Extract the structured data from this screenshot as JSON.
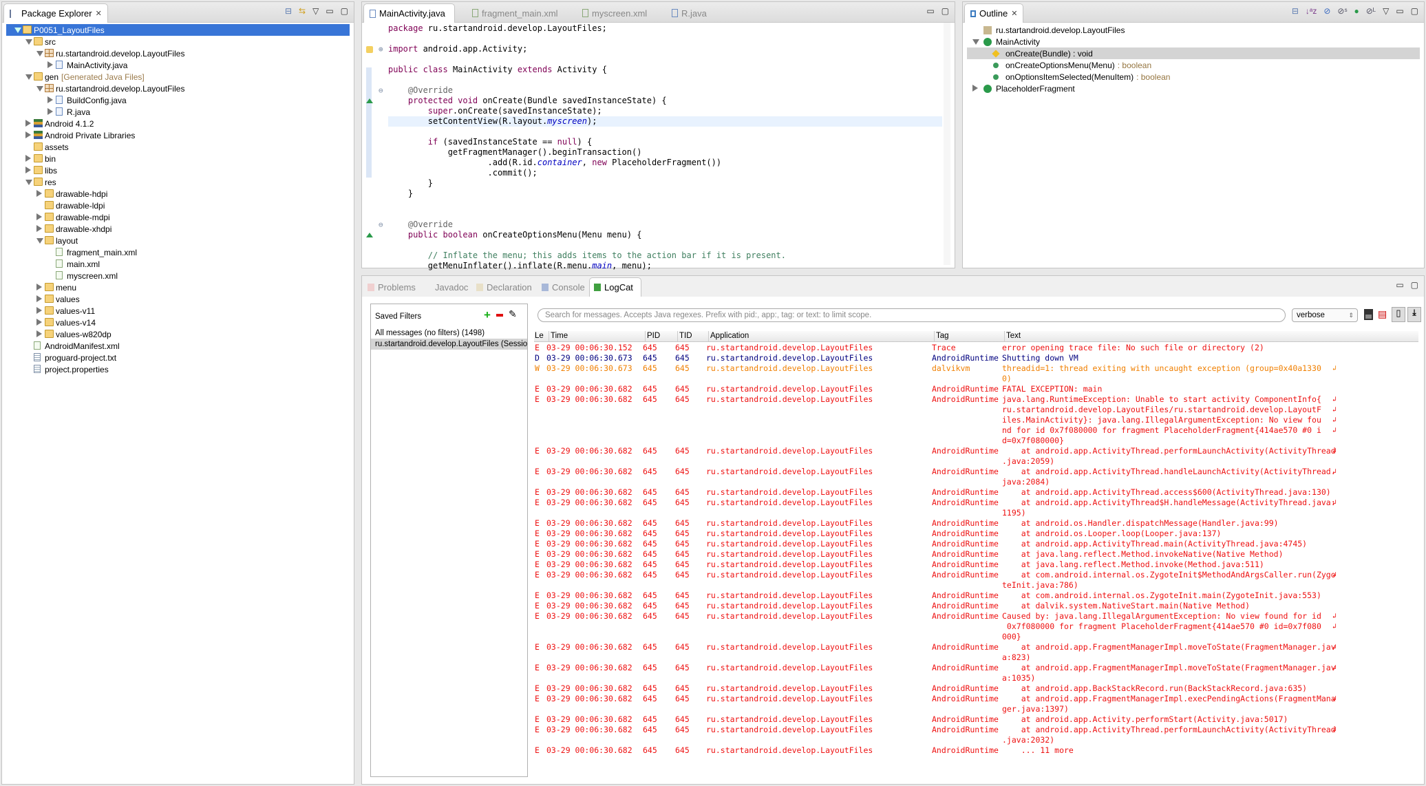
{
  "colors": {
    "error": "#ee1111",
    "debug": "#00007f",
    "warn": "#f07f00",
    "selection": "#3875d7"
  },
  "package_explorer": {
    "title": "Package Explorer",
    "items": [
      {
        "label": "P0051_LayoutFiles",
        "depth": 0,
        "exp": "open",
        "icon": "project",
        "selected": true
      },
      {
        "label": "src",
        "depth": 1,
        "exp": "open",
        "icon": "srcfolder"
      },
      {
        "label": "ru.startandroid.develop.LayoutFiles",
        "depth": 2,
        "exp": "open",
        "icon": "package"
      },
      {
        "label": "MainActivity.java",
        "depth": 3,
        "exp": "closed",
        "icon": "java"
      },
      {
        "label": "gen",
        "suffix": "[Generated Java Files]",
        "depth": 1,
        "exp": "open",
        "icon": "srcfolder"
      },
      {
        "label": "ru.startandroid.develop.LayoutFiles",
        "depth": 2,
        "exp": "open",
        "icon": "package"
      },
      {
        "label": "BuildConfig.java",
        "depth": 3,
        "exp": "closed",
        "icon": "java"
      },
      {
        "label": "R.java",
        "depth": 3,
        "exp": "closed",
        "icon": "java"
      },
      {
        "label": "Android 4.1.2",
        "depth": 1,
        "exp": "closed",
        "icon": "lib"
      },
      {
        "label": "Android Private Libraries",
        "depth": 1,
        "exp": "closed",
        "icon": "lib"
      },
      {
        "label": "assets",
        "depth": 1,
        "exp": "none",
        "icon": "folder"
      },
      {
        "label": "bin",
        "depth": 1,
        "exp": "closed",
        "icon": "folder"
      },
      {
        "label": "libs",
        "depth": 1,
        "exp": "closed",
        "icon": "folder"
      },
      {
        "label": "res",
        "depth": 1,
        "exp": "open",
        "icon": "folder"
      },
      {
        "label": "drawable-hdpi",
        "depth": 2,
        "exp": "closed",
        "icon": "folder"
      },
      {
        "label": "drawable-ldpi",
        "depth": 2,
        "exp": "none",
        "icon": "folder"
      },
      {
        "label": "drawable-mdpi",
        "depth": 2,
        "exp": "closed",
        "icon": "folder"
      },
      {
        "label": "drawable-xhdpi",
        "depth": 2,
        "exp": "closed",
        "icon": "folder"
      },
      {
        "label": "layout",
        "depth": 2,
        "exp": "open",
        "icon": "folder"
      },
      {
        "label": "fragment_main.xml",
        "depth": 3,
        "exp": "none",
        "icon": "xml"
      },
      {
        "label": "main.xml",
        "depth": 3,
        "exp": "none",
        "icon": "xml"
      },
      {
        "label": "myscreen.xml",
        "depth": 3,
        "exp": "none",
        "icon": "xml"
      },
      {
        "label": "menu",
        "depth": 2,
        "exp": "closed",
        "icon": "folder"
      },
      {
        "label": "values",
        "depth": 2,
        "exp": "closed",
        "icon": "folder"
      },
      {
        "label": "values-v11",
        "depth": 2,
        "exp": "closed",
        "icon": "folder"
      },
      {
        "label": "values-v14",
        "depth": 2,
        "exp": "closed",
        "icon": "folder"
      },
      {
        "label": "values-w820dp",
        "depth": 2,
        "exp": "closed",
        "icon": "folder"
      },
      {
        "label": "AndroidManifest.xml",
        "depth": 1,
        "exp": "none",
        "icon": "xml"
      },
      {
        "label": "proguard-project.txt",
        "depth": 1,
        "exp": "none",
        "icon": "txt"
      },
      {
        "label": "project.properties",
        "depth": 1,
        "exp": "none",
        "icon": "txt"
      }
    ]
  },
  "editor": {
    "tabs": [
      "MainActivity.java",
      "fragment_main.xml",
      "myscreen.xml",
      "R.java"
    ],
    "active_tab": 0,
    "current_line": 9,
    "lines": [
      [
        [
          "package",
          "kw"
        ],
        [
          " ru.startandroid.develop.LayoutFiles;",
          ""
        ]
      ],
      [],
      [
        [
          "import",
          "kw"
        ],
        [
          " android.app.Activity;",
          ""
        ]
      ],
      [],
      [
        [
          "public",
          "kw"
        ],
        [
          " ",
          ""
        ],
        [
          "class",
          "kw"
        ],
        [
          " MainActivity ",
          ""
        ],
        [
          "extends",
          "kw"
        ],
        [
          " Activity {",
          ""
        ]
      ],
      [],
      [
        [
          "    @Override",
          "ann"
        ]
      ],
      [
        [
          "    ",
          ""
        ],
        [
          "protected",
          "kw"
        ],
        [
          " ",
          ""
        ],
        [
          "void",
          "kw"
        ],
        [
          " onCreate(Bundle savedInstanceState) {",
          ""
        ]
      ],
      [
        [
          "        ",
          ""
        ],
        [
          "super",
          "kw"
        ],
        [
          ".onCreate(savedInstanceState);",
          ""
        ]
      ],
      [
        [
          "        setContentView(R.layout.",
          ""
        ],
        [
          "myscreen",
          "fld"
        ],
        [
          ");",
          ""
        ]
      ],
      [],
      [
        [
          "        ",
          ""
        ],
        [
          "if",
          "kw"
        ],
        [
          " (savedInstanceState == ",
          ""
        ],
        [
          "null",
          "kw"
        ],
        [
          ") {",
          ""
        ]
      ],
      [
        [
          "            getFragmentManager().beginTransaction()",
          ""
        ]
      ],
      [
        [
          "                    .add(R.id.",
          ""
        ],
        [
          "container",
          "fld"
        ],
        [
          ", ",
          ""
        ],
        [
          "new",
          "kw"
        ],
        [
          " PlaceholderFragment())",
          ""
        ]
      ],
      [
        [
          "                    .commit();",
          ""
        ]
      ],
      [
        [
          "        }",
          ""
        ]
      ],
      [
        [
          "    }",
          ""
        ]
      ],
      [],
      [],
      [
        [
          "    @Override",
          "ann"
        ]
      ],
      [
        [
          "    ",
          ""
        ],
        [
          "public",
          "kw"
        ],
        [
          " ",
          ""
        ],
        [
          "boolean",
          "kw"
        ],
        [
          " onCreateOptionsMenu(Menu menu) {",
          ""
        ]
      ],
      [],
      [
        [
          "        // Inflate the menu; this adds items to the action bar if it is present.",
          "cmt"
        ]
      ],
      [
        [
          "        getMenuInflater().inflate(R.menu.",
          ""
        ],
        [
          "main",
          "fld"
        ],
        [
          ", menu);",
          ""
        ]
      ]
    ]
  },
  "outline": {
    "title": "Outline",
    "items": [
      {
        "label": "ru.startandroid.develop.LayoutFiles",
        "ret": "",
        "depth": 0,
        "icon": "package"
      },
      {
        "label": "MainActivity",
        "ret": "",
        "depth": 0,
        "icon": "class",
        "exp": "open"
      },
      {
        "label": "onCreate(Bundle) : void",
        "ret": "",
        "depth": 1,
        "icon": "protected",
        "selected": true
      },
      {
        "label": "onCreateOptionsMenu(Menu)",
        "ret": ": boolean",
        "depth": 1,
        "icon": "public"
      },
      {
        "label": "onOptionsItemSelected(MenuItem)",
        "ret": ": boolean",
        "depth": 1,
        "icon": "public"
      },
      {
        "label": "PlaceholderFragment",
        "ret": "",
        "depth": 0,
        "icon": "class",
        "exp": "closed"
      }
    ]
  },
  "bottom": {
    "tabs": [
      "Problems",
      "Javadoc",
      "Declaration",
      "Console",
      "LogCat"
    ],
    "active_tab": 4,
    "saved_filters": {
      "title": "Saved Filters",
      "items": [
        "All messages (no filters) (1498)",
        "ru.startandroid.develop.LayoutFiles (Session)"
      ],
      "selected": 1
    },
    "search_placeholder": "Search for messages. Accepts Java regexes. Prefix with pid:, app:, tag: or text: to limit scope.",
    "level_select": "verbose",
    "columns": [
      "Le",
      "Time",
      "PID",
      "TID",
      "Application",
      "Tag",
      "Text"
    ],
    "rows": [
      {
        "l": "E",
        "t": "03-29 00:06:30.152",
        "tag": "Trace",
        "text": [
          "error opening trace file: No such file or directory (2)"
        ]
      },
      {
        "l": "D",
        "t": "03-29 00:06:30.673",
        "tag": "AndroidRuntime",
        "text": [
          "Shutting down VM"
        ]
      },
      {
        "l": "W",
        "t": "03-29 00:06:30.673",
        "tag": "dalvikvm",
        "text": [
          "threadid=1: thread exiting with uncaught exception (group=0x40a1330",
          "0)"
        ]
      },
      {
        "l": "E",
        "t": "03-29 00:06:30.682",
        "tag": "AndroidRuntime",
        "text": [
          "FATAL EXCEPTION: main"
        ]
      },
      {
        "l": "E",
        "t": "03-29 00:06:30.682",
        "tag": "AndroidRuntime",
        "text": [
          "java.lang.RuntimeException: Unable to start activity ComponentInfo{",
          "ru.startandroid.develop.LayoutFiles/ru.startandroid.develop.LayoutF",
          "iles.MainActivity}: java.lang.IllegalArgumentException: No view fou",
          "nd for id 0x7f080000 for fragment PlaceholderFragment{414ae570 #0 i",
          "d=0x7f080000}"
        ]
      },
      {
        "l": "E",
        "t": "03-29 00:06:30.682",
        "tag": "AndroidRuntime",
        "text": [
          "    at android.app.ActivityThread.performLaunchActivity(ActivityThread",
          ".java:2059)"
        ]
      },
      {
        "l": "E",
        "t": "03-29 00:06:30.682",
        "tag": "AndroidRuntime",
        "text": [
          "    at android.app.ActivityThread.handleLaunchActivity(ActivityThread.",
          "java:2084)"
        ]
      },
      {
        "l": "E",
        "t": "03-29 00:06:30.682",
        "tag": "AndroidRuntime",
        "text": [
          "    at android.app.ActivityThread.access$600(ActivityThread.java:130)"
        ]
      },
      {
        "l": "E",
        "t": "03-29 00:06:30.682",
        "tag": "AndroidRuntime",
        "text": [
          "    at android.app.ActivityThread$H.handleMessage(ActivityThread.java:",
          "1195)"
        ]
      },
      {
        "l": "E",
        "t": "03-29 00:06:30.682",
        "tag": "AndroidRuntime",
        "text": [
          "    at android.os.Handler.dispatchMessage(Handler.java:99)"
        ]
      },
      {
        "l": "E",
        "t": "03-29 00:06:30.682",
        "tag": "AndroidRuntime",
        "text": [
          "    at android.os.Looper.loop(Looper.java:137)"
        ]
      },
      {
        "l": "E",
        "t": "03-29 00:06:30.682",
        "tag": "AndroidRuntime",
        "text": [
          "    at android.app.ActivityThread.main(ActivityThread.java:4745)"
        ]
      },
      {
        "l": "E",
        "t": "03-29 00:06:30.682",
        "tag": "AndroidRuntime",
        "text": [
          "    at java.lang.reflect.Method.invokeNative(Native Method)"
        ]
      },
      {
        "l": "E",
        "t": "03-29 00:06:30.682",
        "tag": "AndroidRuntime",
        "text": [
          "    at java.lang.reflect.Method.invoke(Method.java:511)"
        ]
      },
      {
        "l": "E",
        "t": "03-29 00:06:30.682",
        "tag": "AndroidRuntime",
        "text": [
          "    at com.android.internal.os.ZygoteInit$MethodAndArgsCaller.run(Zygo",
          "teInit.java:786)"
        ]
      },
      {
        "l": "E",
        "t": "03-29 00:06:30.682",
        "tag": "AndroidRuntime",
        "text": [
          "    at com.android.internal.os.ZygoteInit.main(ZygoteInit.java:553)"
        ]
      },
      {
        "l": "E",
        "t": "03-29 00:06:30.682",
        "tag": "AndroidRuntime",
        "text": [
          "    at dalvik.system.NativeStart.main(Native Method)"
        ]
      },
      {
        "l": "E",
        "t": "03-29 00:06:30.682",
        "tag": "AndroidRuntime",
        "text": [
          "Caused by: java.lang.IllegalArgumentException: No view found for id",
          " 0x7f080000 for fragment PlaceholderFragment{414ae570 #0 id=0x7f080",
          "000}"
        ]
      },
      {
        "l": "E",
        "t": "03-29 00:06:30.682",
        "tag": "AndroidRuntime",
        "text": [
          "    at android.app.FragmentManagerImpl.moveToState(FragmentManager.jav",
          "a:823)"
        ]
      },
      {
        "l": "E",
        "t": "03-29 00:06:30.682",
        "tag": "AndroidRuntime",
        "text": [
          "    at android.app.FragmentManagerImpl.moveToState(FragmentManager.jav",
          "a:1035)"
        ]
      },
      {
        "l": "E",
        "t": "03-29 00:06:30.682",
        "tag": "AndroidRuntime",
        "text": [
          "    at android.app.BackStackRecord.run(BackStackRecord.java:635)"
        ]
      },
      {
        "l": "E",
        "t": "03-29 00:06:30.682",
        "tag": "AndroidRuntime",
        "text": [
          "    at android.app.FragmentManagerImpl.execPendingActions(FragmentMana",
          "ger.java:1397)"
        ]
      },
      {
        "l": "E",
        "t": "03-29 00:06:30.682",
        "tag": "AndroidRuntime",
        "text": [
          "    at android.app.Activity.performStart(Activity.java:5017)"
        ]
      },
      {
        "l": "E",
        "t": "03-29 00:06:30.682",
        "tag": "AndroidRuntime",
        "text": [
          "    at android.app.ActivityThread.performLaunchActivity(ActivityThread",
          ".java:2032)"
        ]
      },
      {
        "l": "E",
        "t": "03-29 00:06:30.682",
        "tag": "AndroidRuntime",
        "text": [
          "    ... 11 more"
        ]
      }
    ],
    "pid": "645",
    "tid": "645",
    "app": "ru.startandroid.develop.LayoutFiles"
  }
}
